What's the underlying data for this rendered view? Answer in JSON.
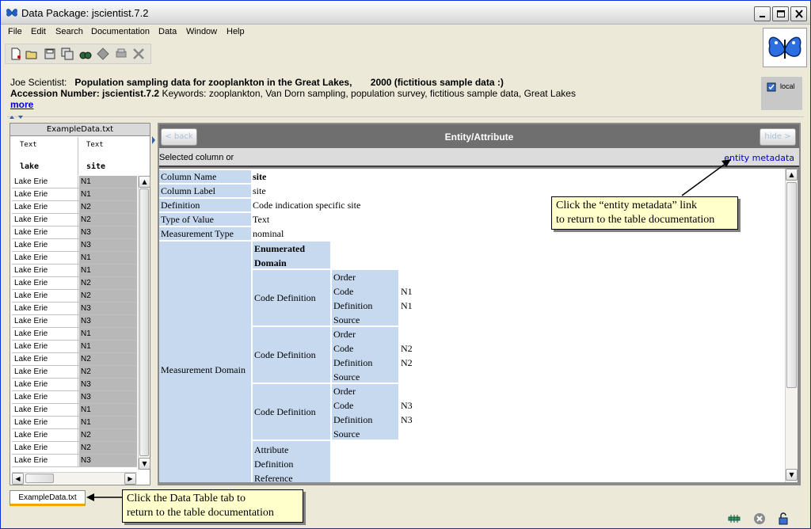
{
  "window": {
    "title": "Data Package: jscientist.7.2"
  },
  "menu": [
    "File",
    "Edit",
    "Search",
    "Documentation",
    "Data",
    "Window",
    "Help"
  ],
  "header": {
    "author": "Joe Scientist:",
    "title_text": "Population sampling data for zooplankton in the Great Lakes,",
    "year_text": "2000 (fictitious sample data :)",
    "accession_label": "Accession Number:",
    "accession_value": "jscientist.7.2",
    "keywords_label": "Keywords:",
    "keywords": "zooplankton, Van Dorn sampling, population survey, fictitious sample data, Great Lakes",
    "more_link": "more",
    "location": "local"
  },
  "table": {
    "title": "ExampleData.txt",
    "columns": [
      {
        "type": "Text",
        "name": "lake"
      },
      {
        "type": "Text",
        "name": "site"
      }
    ],
    "rows": [
      [
        "Lake Erie",
        "N1"
      ],
      [
        "Lake Erie",
        "N1"
      ],
      [
        "Lake Erie",
        "N2"
      ],
      [
        "Lake Erie",
        "N2"
      ],
      [
        "Lake Erie",
        "N3"
      ],
      [
        "Lake Erie",
        "N3"
      ],
      [
        "Lake Erie",
        "N1"
      ],
      [
        "Lake Erie",
        "N1"
      ],
      [
        "Lake Erie",
        "N2"
      ],
      [
        "Lake Erie",
        "N2"
      ],
      [
        "Lake Erie",
        "N3"
      ],
      [
        "Lake Erie",
        "N3"
      ],
      [
        "Lake Erie",
        "N1"
      ],
      [
        "Lake Erie",
        "N1"
      ],
      [
        "Lake Erie",
        "N2"
      ],
      [
        "Lake Erie",
        "N2"
      ],
      [
        "Lake Erie",
        "N3"
      ],
      [
        "Lake Erie",
        "N3"
      ],
      [
        "Lake Erie",
        "N1"
      ],
      [
        "Lake Erie",
        "N1"
      ],
      [
        "Lake Erie",
        "N2"
      ],
      [
        "Lake Erie",
        "N2"
      ],
      [
        "Lake Erie",
        "N3"
      ]
    ],
    "tab_label": "ExampleData.txt"
  },
  "entity": {
    "panel_title": "Entity/Attribute",
    "back_label": "< back",
    "hide_label": "hide >",
    "selected_text": "Selected column or",
    "entity_metadata_link": "entity metadata",
    "fields": {
      "column_name_label": "Column Name",
      "column_name_value": "site",
      "column_label_label": "Column Label",
      "column_label_value": "site",
      "definition_label": "Definition",
      "definition_value": "Code indication specific site",
      "type_label": "Type of Value",
      "type_value": "Text",
      "measurement_type_label": "Measurement Type",
      "measurement_type_value": "nominal",
      "measurement_domain_label": "Measurement Domain",
      "enumerated_domain": "Enumerated Domain",
      "code_definition_label": "Code Definition",
      "order_label": "Order",
      "code_label": "Code",
      "definition_sub_label": "Definition",
      "source_label": "Source",
      "attribute_definition_reference": "Attribute Definition Reference"
    },
    "codes": [
      {
        "code": "N1",
        "definition": "N1"
      },
      {
        "code": "N2",
        "definition": "N2"
      },
      {
        "code": "N3",
        "definition": "N3"
      }
    ]
  },
  "callouts": {
    "entity_metadata": [
      "Click the “entity metadata” link",
      "to return to the table documentation"
    ],
    "data_table_tab": [
      "Click the Data Table tab to",
      "return to the table documentation"
    ]
  },
  "colors": {
    "attribute_label_bg": "#c6d9ef",
    "link": "#0000cc",
    "callout_bg": "#ffffcc",
    "tab_accent": "#f5a500"
  }
}
